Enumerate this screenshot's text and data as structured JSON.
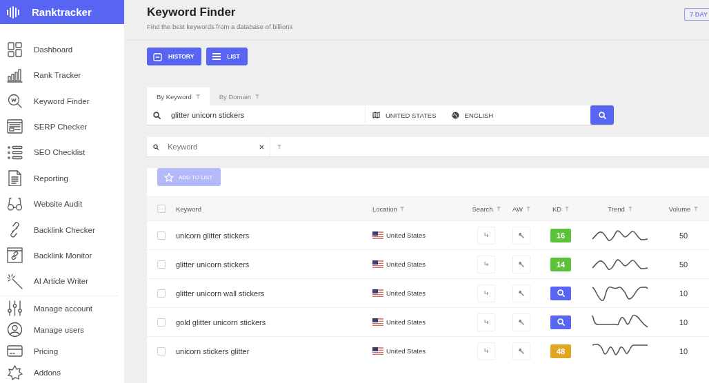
{
  "app": {
    "name": "Ranktracker"
  },
  "sidebar": {
    "main_items": [
      "Dashboard",
      "Rank Tracker",
      "Keyword Finder",
      "SERP Checker",
      "SEO Checklist",
      "Reporting",
      "Website Audit",
      "Backlink Checker",
      "Backlink Monitor",
      "AI Article Writer"
    ],
    "account_items": [
      "Manage account",
      "Manage users",
      "Pricing",
      "Addons"
    ]
  },
  "header": {
    "title": "Keyword Finder",
    "subtitle": "Find the best keywords from a database of billions",
    "period_badge": "7 DAY"
  },
  "buttons": [
    "HISTORY",
    "LIST"
  ],
  "search_tabs": [
    {
      "label": "By Keyword",
      "selected": true
    },
    {
      "label": "By Domain",
      "selected": false
    }
  ],
  "search": {
    "value": "glitter unicorn stickers",
    "location": "UNITED STATES",
    "language": "ENGLISH"
  },
  "filter": {
    "placeholder": "Keyword"
  },
  "table": {
    "add_button": {
      "label": "ADD TO LIST",
      "disabled": true
    },
    "select_all_checked": false,
    "columns": [
      {
        "label": "Keyword",
        "filterable": false
      },
      {
        "label": "Location",
        "filterable": true
      },
      {
        "label": "Search",
        "filterable": true
      },
      {
        "label": "AW",
        "filterable": true
      },
      {
        "label": "KD",
        "filterable": true
      },
      {
        "label": "Trend",
        "filterable": true
      },
      {
        "label": "Volume",
        "filterable": true
      }
    ],
    "rows": [
      {
        "checked": false,
        "keyword": "unicorn glitter stickers",
        "location": "United States",
        "kd": {
          "kind": "score",
          "value": "16",
          "color": "#5cc23a"
        },
        "volume": "50"
      },
      {
        "checked": false,
        "keyword": "glitter unicorn stickers",
        "location": "United States",
        "kd": {
          "kind": "score",
          "value": "14",
          "color": "#5cc23a"
        },
        "volume": "50"
      },
      {
        "checked": false,
        "keyword": "glitter unicorn wall stickers",
        "location": "United States",
        "kd": {
          "kind": "lookup",
          "color": "#5865f2"
        },
        "volume": "10"
      },
      {
        "checked": false,
        "keyword": "gold glitter unicorn stickers",
        "location": "United States",
        "kd": {
          "kind": "lookup",
          "color": "#5865f2"
        },
        "volume": "10"
      },
      {
        "checked": false,
        "keyword": "unicorn stickers glitter",
        "location": "United States",
        "kd": {
          "kind": "score",
          "value": "48",
          "color": "#e3a623"
        },
        "volume": "10"
      }
    ]
  }
}
